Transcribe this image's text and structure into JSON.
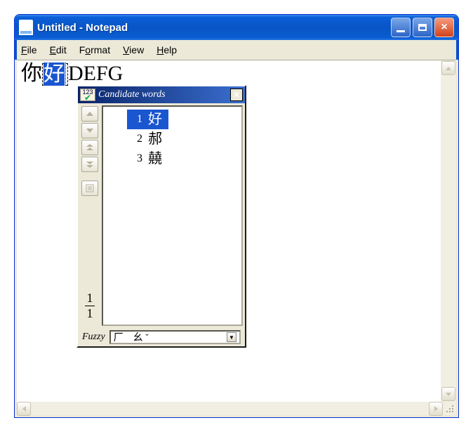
{
  "window": {
    "title": "Untitled - Notepad"
  },
  "menu": {
    "file": "File",
    "edit": "Edit",
    "format": "Format",
    "view": "View",
    "help": "Help"
  },
  "editor": {
    "before_text": "你",
    "composing_selected": "好",
    "composing_caret": "",
    "after_text": "DEFG"
  },
  "ime": {
    "title": "Candidate words",
    "icon_text": "123",
    "candidates": [
      {
        "n": "1",
        "ch": "好"
      },
      {
        "n": "2",
        "ch": "郝"
      },
      {
        "n": "3",
        "ch": "㚁"
      }
    ],
    "page_current": "1",
    "page_total": "1",
    "footer_label": "Fuzzy",
    "reading": "厂　幺 ˇ"
  }
}
